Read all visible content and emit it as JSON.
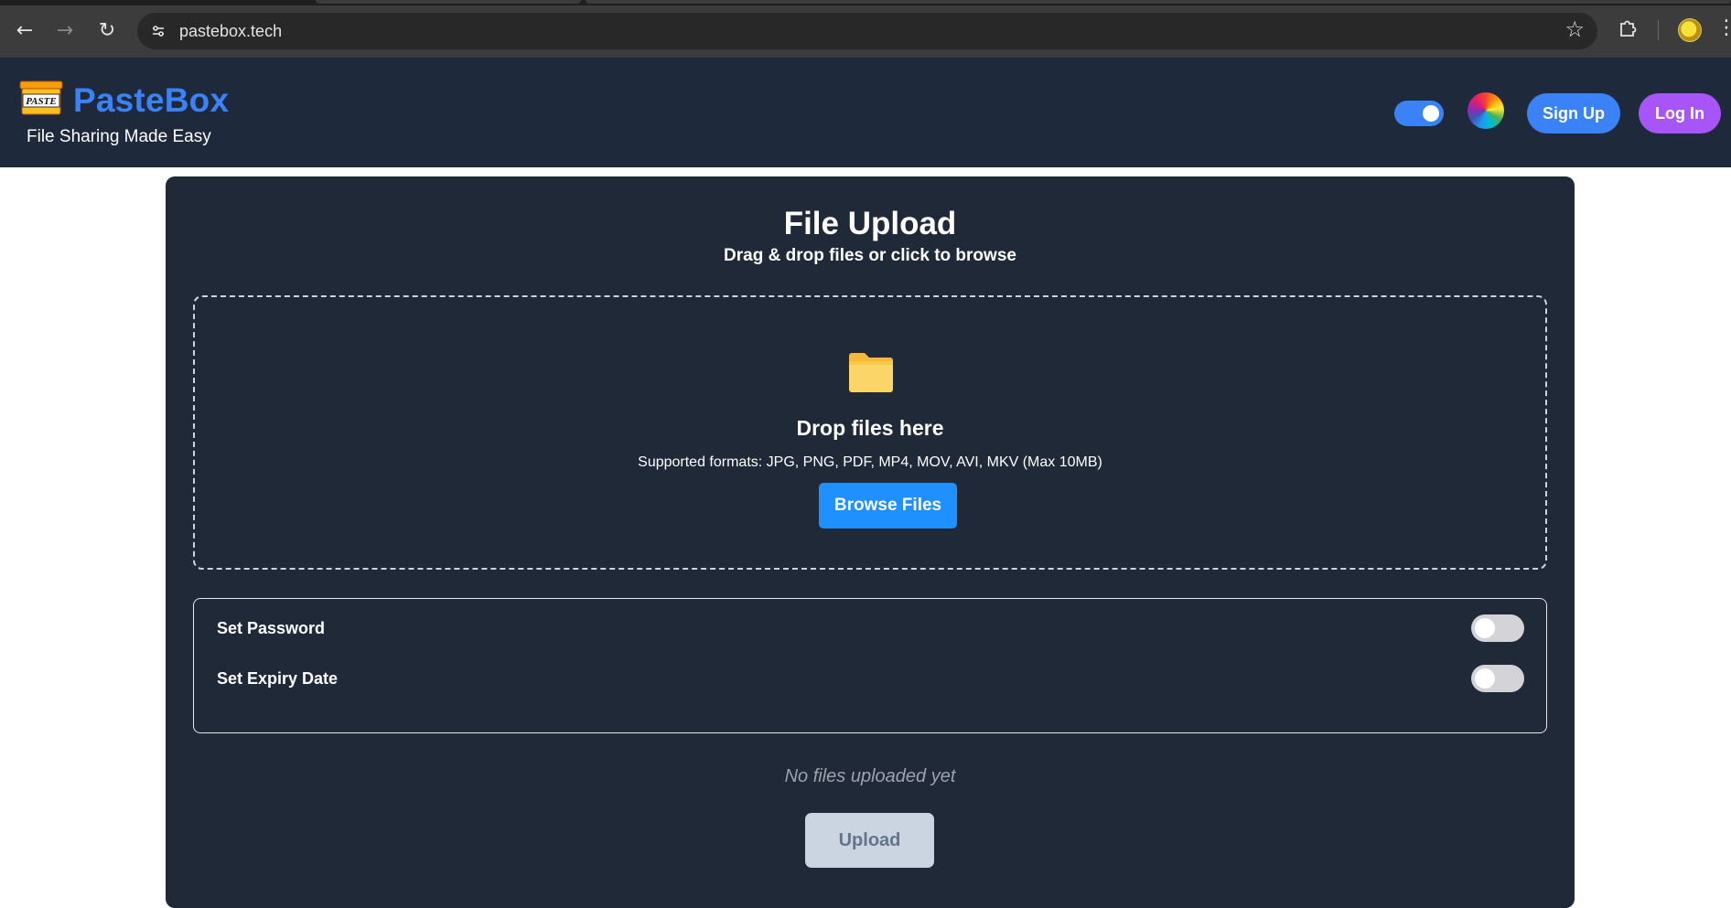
{
  "browser": {
    "url": "pastebox.tech",
    "icons": {
      "back": "back-arrow-icon",
      "forward": "forward-arrow-icon",
      "reload": "reload-icon",
      "site_info": "site-info-icon",
      "bookmark": "star-icon",
      "extensions": "puzzle-icon",
      "menu": "more-icon"
    }
  },
  "header": {
    "logo_badge": "PASTE",
    "brand": "PasteBox",
    "tagline": "File Sharing Made Easy",
    "theme_toggle_on": true,
    "signup_label": "Sign Up",
    "login_label": "Log In",
    "colors": {
      "background": "#1e293b",
      "brand": "#3b82f6",
      "signup": "#3b82f6",
      "login": "#a855f7"
    }
  },
  "upload": {
    "title": "File Upload",
    "subtitle": "Drag & drop files or click to browse",
    "drop_title": "Drop files here",
    "formats": "Supported formats: JPG, PNG, PDF, MP4, MOV, AVI, MKV (Max 10MB)",
    "browse_label": "Browse Files",
    "options": [
      {
        "label": "Set Password",
        "enabled": false
      },
      {
        "label": "Set Expiry Date",
        "enabled": false
      }
    ],
    "empty_text": "No files uploaded yet",
    "upload_label": "Upload",
    "colors": {
      "card": "#1f2937",
      "browse": "#1e90ff",
      "upload_disabled": "#cbd5e1"
    }
  }
}
